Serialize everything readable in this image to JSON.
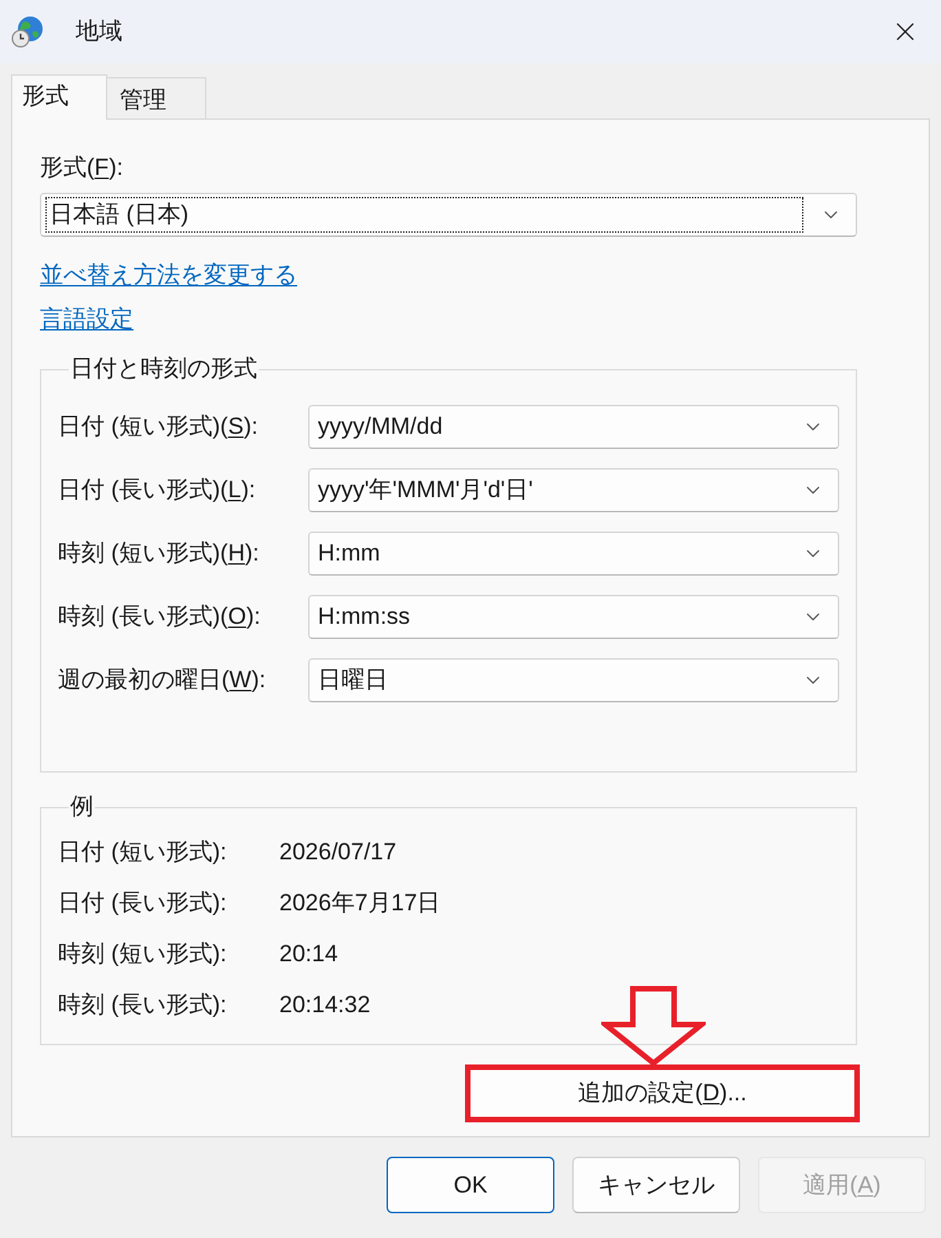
{
  "window": {
    "title": "地域"
  },
  "tabs": [
    {
      "label": "形式",
      "selected": true
    },
    {
      "label": "管理",
      "selected": false
    }
  ],
  "format": {
    "label": {
      "before": "形式(",
      "key": "F",
      "after": "):"
    },
    "value": "日本語 (日本)",
    "focused": true
  },
  "links": [
    "並べ替え方法を変更する",
    "言語設定"
  ],
  "date_time_formats": {
    "title": "日付と時刻の形式",
    "rows": [
      {
        "label": {
          "before": "日付 (短い形式)(",
          "key": "S",
          "after": "):"
        },
        "value": "yyyy/MM/dd"
      },
      {
        "label": {
          "before": "日付 (長い形式)(",
          "key": "L",
          "after": "):"
        },
        "value": "yyyy'年'MMM'月'd'日'"
      },
      {
        "label": {
          "before": "時刻 (短い形式)(",
          "key": "H",
          "after": "):"
        },
        "value": "H:mm"
      },
      {
        "label": {
          "before": "時刻 (長い形式)(",
          "key": "O",
          "after": "):"
        },
        "value": "H:mm:ss"
      },
      {
        "label": {
          "before": "週の最初の曜日(",
          "key": "W",
          "after": "):"
        },
        "value": "日曜日"
      }
    ]
  },
  "examples": {
    "title": "例",
    "rows": [
      {
        "label": "日付 (短い形式):",
        "value": "2026/07/17"
      },
      {
        "label": "日付 (長い形式):",
        "value": "2026年7月17日"
      },
      {
        "label": "時刻 (短い形式):",
        "value": "20:14"
      },
      {
        "label": "時刻 (長い形式):",
        "value": "20:14:32"
      }
    ]
  },
  "additional_settings": {
    "label": {
      "before": "追加の設定(",
      "key": "D",
      "after": ")..."
    },
    "highlighted": true
  },
  "buttons": [
    {
      "label": "OK",
      "kind": "default",
      "disabled": false
    },
    {
      "label": "キャンセル",
      "kind": "normal",
      "disabled": false
    },
    {
      "label": {
        "before": "適用(",
        "key": "A",
        "after": ")"
      },
      "kind": "normal",
      "disabled": true
    }
  ]
}
